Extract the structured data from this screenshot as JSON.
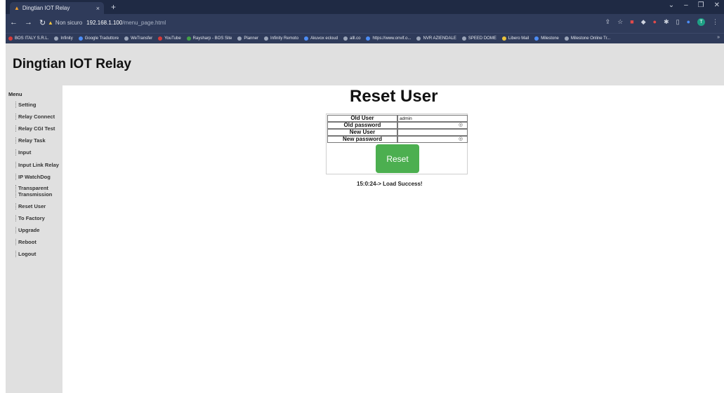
{
  "browser": {
    "tab_title": "Dingtian IOT Relay",
    "tab_close": "×",
    "new_tab": "+",
    "security_label": "Non sicuro",
    "url_host": "192.168.1.100",
    "url_path": "/menu_page.html",
    "bookmarks": [
      "BOS ITALY S.R.L.",
      "Infinity",
      "Google Traduttore",
      "WeTransfer",
      "YouTube",
      "Raysharp - BOS Site",
      "Planner",
      "Infinity Remoto",
      "Akuvox ecloud",
      "alll.co",
      "https://www.onvif.o...",
      "NVR AZIENDALE",
      "SPEED DOME",
      "Libero Mail",
      "Milestone",
      "Milestone Online Tr..."
    ],
    "bookmarks_more": "»"
  },
  "header": {
    "title": "Dingtian IOT Relay"
  },
  "sidebar": {
    "heading": "Menu",
    "items": [
      "Setting",
      "Relay Connect",
      "Relay CGI Test",
      "Relay Task",
      "Input",
      "Input Link Relay",
      "IP WatchDog",
      "Transparent Transmission",
      "Reset User",
      "To Factory",
      "Upgrade",
      "Reboot",
      "Logout"
    ]
  },
  "main": {
    "title": "Reset User",
    "form": {
      "old_user_label": "Old User",
      "old_user_value": "admin",
      "old_password_label": "Old password",
      "new_user_label": "New User",
      "new_password_label": "New password",
      "reset_label": "Reset"
    },
    "status": "15:0:24-> Load Success!"
  }
}
